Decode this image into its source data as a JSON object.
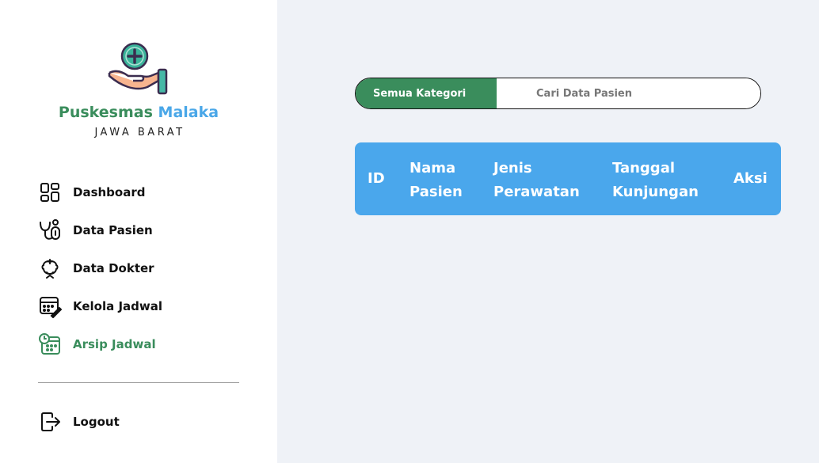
{
  "sidebar": {
    "brand": {
      "part1": "Puskesmas",
      "part2": "Malaka",
      "subtitle": "JAWA BARAT",
      "logo_icon": "hand-holding-medical-icon"
    },
    "items": [
      {
        "label": "Dashboard",
        "icon": "dashboard-icon",
        "active": false
      },
      {
        "label": "Data Pasien",
        "icon": "stethoscope-icon",
        "active": false
      },
      {
        "label": "Data Dokter",
        "icon": "doctor-icon",
        "active": false
      },
      {
        "label": "Kelola Jadwal",
        "icon": "calendar-edit-icon",
        "active": false
      },
      {
        "label": "Arsip Jadwal",
        "icon": "calendar-clock-icon",
        "active": true
      }
    ],
    "logout": {
      "label": "Logout",
      "icon": "logout-icon"
    }
  },
  "search": {
    "category_label": "Semua Kategori",
    "placeholder": "Cari Data Pasien"
  },
  "table": {
    "headers": [
      "ID",
      "Nama Pasien",
      "Jenis Perawatan",
      "Tanggal Kunjungan",
      "Aksi"
    ],
    "header_lines": [
      [
        "ID"
      ],
      [
        "Nama",
        "Pasien"
      ],
      [
        "Jenis",
        "Perawatan"
      ],
      [
        "Tanggal",
        "Kunjungan"
      ],
      [
        "Aksi"
      ]
    ]
  },
  "colors": {
    "primary_green": "#3a8d5c",
    "accent_blue": "#4aa7ec",
    "background": "#eff2f7"
  }
}
